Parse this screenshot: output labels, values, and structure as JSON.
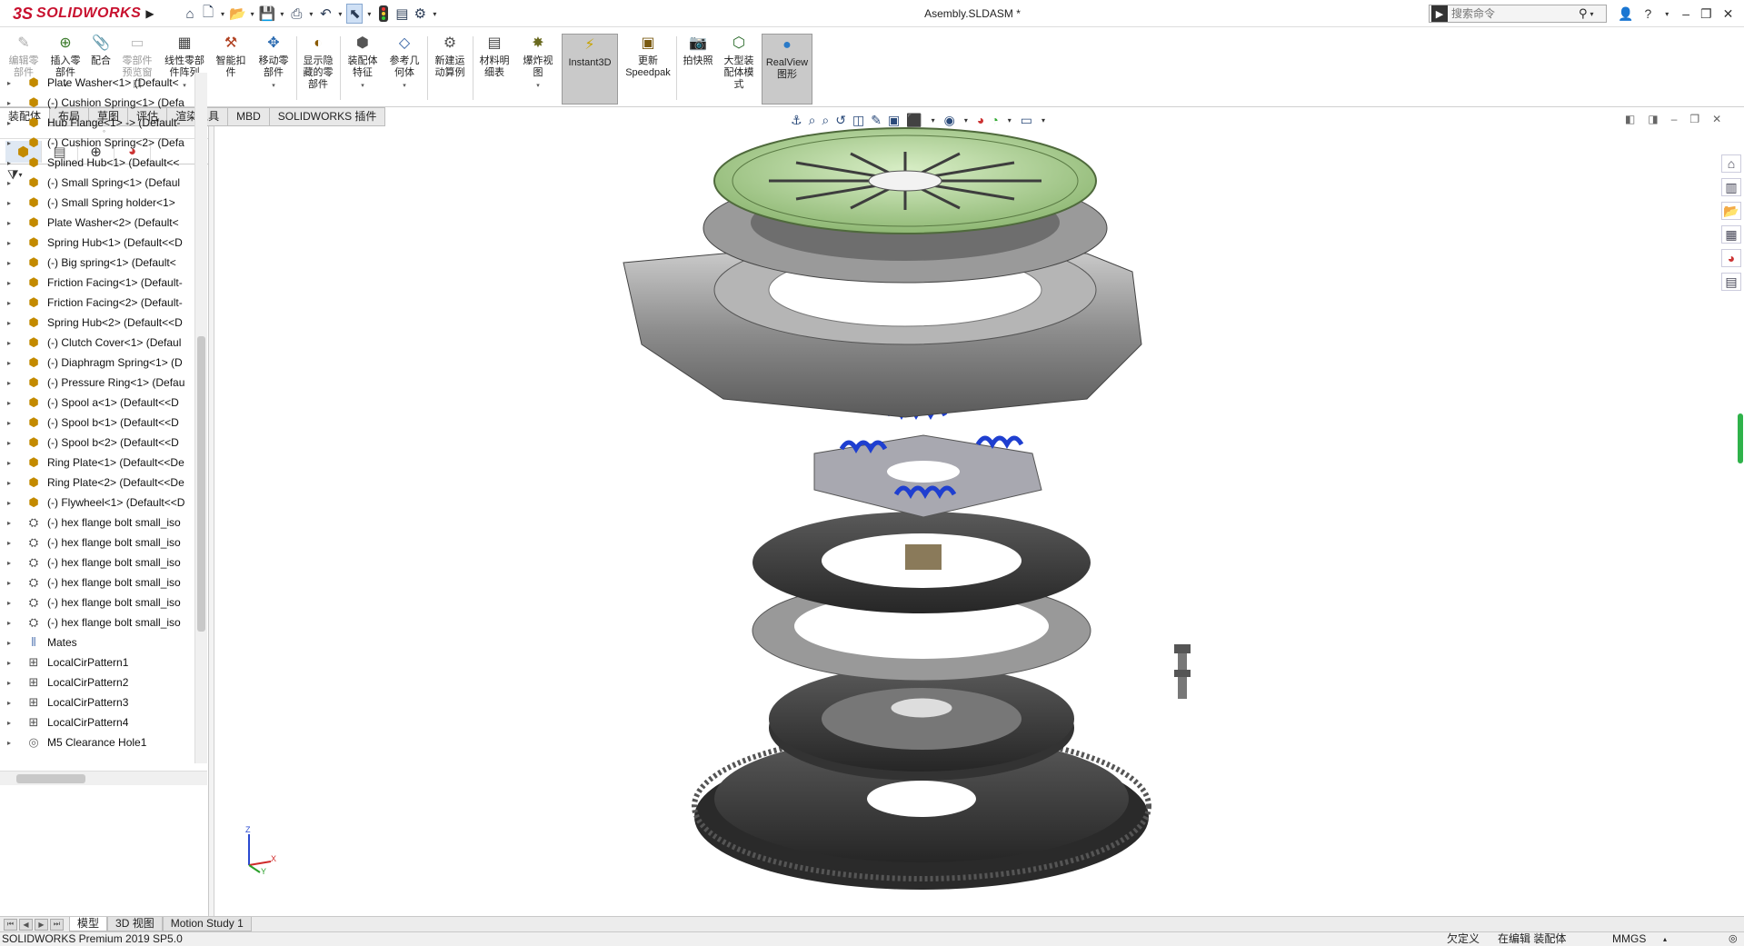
{
  "app": {
    "brand_ds": "3S",
    "brand_name": "SOLIDWORKS",
    "doc_title": "Asembly.SLDASM *"
  },
  "search": {
    "placeholder": "搜索命令"
  },
  "quick_access": [
    "home-icon",
    "new-icon",
    "open-icon",
    "save-icon",
    "print-icon",
    "undo-icon",
    "select-icon",
    "traffic-light-icon",
    "file-props-icon",
    "options-icon"
  ],
  "ribbon": {
    "items": [
      {
        "label": "编辑零\n部件",
        "disabled": true,
        "icon": "edit-part-icon"
      },
      {
        "label": "插入零\n部件",
        "disabled": false,
        "icon": "insert-part-icon",
        "dropdown": true
      },
      {
        "label": "配合",
        "disabled": false,
        "icon": "mate-icon"
      },
      {
        "label": "零部件\n预览窗\n口",
        "disabled": true,
        "icon": "preview-window-icon"
      },
      {
        "label": "线性零部\n件阵列",
        "disabled": false,
        "icon": "linear-pattern-icon",
        "dropdown": true
      },
      {
        "label": "智能扣\n件",
        "disabled": false,
        "icon": "smart-fastener-icon"
      },
      {
        "label": "移动零\n部件",
        "disabled": false,
        "icon": "move-part-icon",
        "dropdown": true
      },
      {
        "label": "显示隐\n藏的零\n部件",
        "disabled": false,
        "icon": "show-hidden-icon"
      },
      {
        "label": "装配体\n特征",
        "disabled": false,
        "icon": "assembly-feature-icon",
        "dropdown": true
      },
      {
        "label": "参考几\n何体",
        "disabled": false,
        "icon": "ref-geometry-icon",
        "dropdown": true
      },
      {
        "label": "新建运\n动算例",
        "disabled": false,
        "icon": "motion-study-icon"
      },
      {
        "label": "材料明\n细表",
        "disabled": false,
        "icon": "bom-icon"
      },
      {
        "label": "爆炸视\n图",
        "disabled": false,
        "icon": "exploded-view-icon",
        "dropdown": true
      },
      {
        "label": "Instant3D",
        "disabled": false,
        "icon": "instant3d-icon",
        "active": true
      },
      {
        "label": "更新\nSpeedpak",
        "disabled": false,
        "icon": "speedpak-icon"
      },
      {
        "label": "拍快照",
        "disabled": false,
        "icon": "snapshot-icon"
      },
      {
        "label": "大型装\n配体模\n式",
        "disabled": false,
        "icon": "large-assembly-icon"
      },
      {
        "label": "RealView\n图形",
        "disabled": false,
        "icon": "realview-icon",
        "active": true
      }
    ]
  },
  "command_tabs": [
    "装配体",
    "布局",
    "草图",
    "评估",
    "渲染工具",
    "MBD",
    "SOLIDWORKS 插件"
  ],
  "tree": [
    {
      "type": "comp",
      "label": "Plate Washer<1> (Default<"
    },
    {
      "type": "comp",
      "label": "(-) Cushion Spring<1> (Defa"
    },
    {
      "type": "comp",
      "label": "Hub Flange<1> -> (Default-"
    },
    {
      "type": "comp",
      "label": "(-) Cushion Spring<2> (Defa"
    },
    {
      "type": "comp",
      "label": "Splined Hub<1> (Default<<"
    },
    {
      "type": "comp",
      "label": "(-) Small Spring<1> (Defaul"
    },
    {
      "type": "comp",
      "label": "(-) Small Spring holder<1>"
    },
    {
      "type": "comp",
      "label": "Plate Washer<2> (Default<"
    },
    {
      "type": "comp",
      "label": "Spring Hub<1> (Default<<D"
    },
    {
      "type": "comp",
      "label": "(-) Big spring<1> (Default<"
    },
    {
      "type": "comp",
      "label": "Friction Facing<1> (Default-"
    },
    {
      "type": "comp",
      "label": "Friction Facing<2> (Default-"
    },
    {
      "type": "comp",
      "label": "Spring Hub<2> (Default<<D"
    },
    {
      "type": "comp",
      "label": "(-) Clutch Cover<1> (Defaul"
    },
    {
      "type": "comp",
      "label": "(-) Diaphragm Spring<1> (D"
    },
    {
      "type": "comp",
      "label": "(-) Pressure Ring<1> (Defau"
    },
    {
      "type": "comp",
      "label": "(-) Spool a<1> (Default<<D"
    },
    {
      "type": "comp",
      "label": "(-) Spool b<1> (Default<<D"
    },
    {
      "type": "comp",
      "label": "(-) Spool b<2> (Default<<D"
    },
    {
      "type": "comp",
      "label": "Ring Plate<1> (Default<<De"
    },
    {
      "type": "comp",
      "label": "Ring Plate<2> (Default<<De"
    },
    {
      "type": "comp",
      "label": "(-) Flywheel<1> (Default<<D"
    },
    {
      "type": "bolt",
      "label": "(-) hex flange bolt small_iso"
    },
    {
      "type": "bolt",
      "label": "(-) hex flange bolt small_iso"
    },
    {
      "type": "bolt",
      "label": "(-) hex flange bolt small_iso"
    },
    {
      "type": "bolt",
      "label": "(-) hex flange bolt small_iso"
    },
    {
      "type": "bolt",
      "label": "(-) hex flange bolt small_iso"
    },
    {
      "type": "bolt",
      "label": "(-) hex flange bolt small_iso"
    },
    {
      "type": "mate",
      "label": "Mates"
    },
    {
      "type": "pattern",
      "label": "LocalCirPattern1"
    },
    {
      "type": "pattern",
      "label": "LocalCirPattern2"
    },
    {
      "type": "pattern",
      "label": "LocalCirPattern3"
    },
    {
      "type": "pattern",
      "label": "LocalCirPattern4"
    },
    {
      "type": "hole",
      "label": "M5 Clearance Hole1"
    }
  ],
  "bottom_tabs": [
    "模型",
    "3D 视图",
    "Motion Study 1"
  ],
  "status": {
    "product": "SOLIDWORKS Premium 2019 SP5.0",
    "defined": "欠定义",
    "editing": "在编辑 装配体",
    "units": "MMGS"
  },
  "triad": {
    "x": "X",
    "y": "Y",
    "z": "Z"
  },
  "colors": {
    "brand": "#c8102e",
    "spring_blue": "#1f3fd0",
    "cover_green": "#a9cf8f",
    "friction_dark": "#3a3a3a"
  }
}
